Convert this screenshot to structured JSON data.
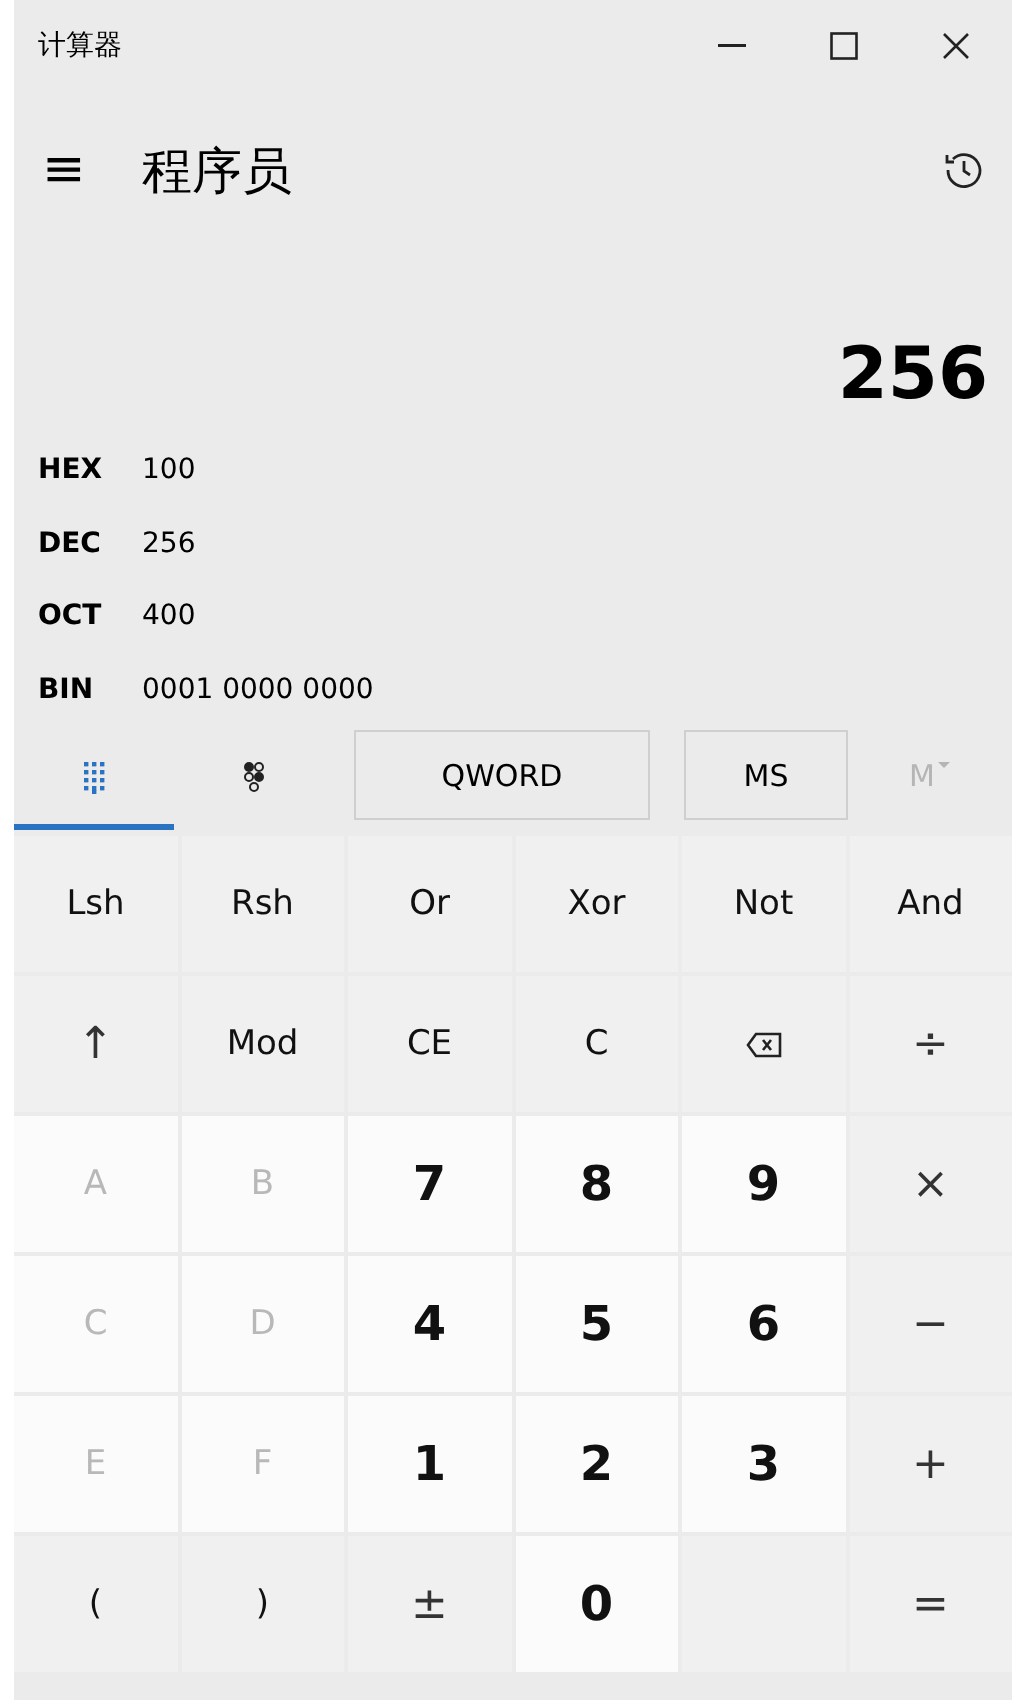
{
  "window": {
    "title": "计算器",
    "controls": [
      {
        "kind": "minimize"
      },
      {
        "kind": "maximize"
      },
      {
        "kind": "close"
      }
    ]
  },
  "header": {
    "menu": "≡",
    "mode": "程序员"
  },
  "display": {
    "value": "256"
  },
  "radix": [
    {
      "name": "HEX",
      "value": "100"
    },
    {
      "name": "DEC",
      "value": "256"
    },
    {
      "name": "OCT",
      "value": "400"
    },
    {
      "name": "BIN",
      "value": "0001 0000 0000"
    }
  ],
  "keypad_tabs": [
    {
      "kind": "keypad",
      "selected": true
    },
    {
      "kind": "bits",
      "selected": false
    }
  ],
  "word_size": "QWORD",
  "memory_buttons": [
    {
      "label": "MS",
      "disabled": false,
      "dropdown": false
    },
    {
      "label": "M",
      "disabled": true,
      "dropdown": true
    }
  ],
  "keys": [
    {
      "label": "Lsh",
      "kind": "function"
    },
    {
      "label": "Rsh",
      "kind": "function"
    },
    {
      "label": "Or",
      "kind": "function"
    },
    {
      "label": "Xor",
      "kind": "function"
    },
    {
      "label": "Not",
      "kind": "function"
    },
    {
      "label": "And",
      "kind": "function"
    },
    {
      "label": "↑",
      "kind": "operator"
    },
    {
      "label": "Mod",
      "kind": "function"
    },
    {
      "label": "CE",
      "kind": "function"
    },
    {
      "label": "C",
      "kind": "function"
    },
    {
      "kind": "backspace"
    },
    {
      "label": "÷",
      "kind": "operator"
    },
    {
      "label": "A",
      "kind": "letter"
    },
    {
      "label": "B",
      "kind": "letter"
    },
    {
      "label": "7",
      "kind": "digit"
    },
    {
      "label": "8",
      "kind": "digit"
    },
    {
      "label": "9",
      "kind": "digit"
    },
    {
      "label": "×",
      "kind": "operator"
    },
    {
      "label": "C",
      "kind": "letter"
    },
    {
      "label": "D",
      "kind": "letter"
    },
    {
      "label": "4",
      "kind": "digit"
    },
    {
      "label": "5",
      "kind": "digit"
    },
    {
      "label": "6",
      "kind": "digit"
    },
    {
      "label": "−",
      "kind": "operator"
    },
    {
      "label": "E",
      "kind": "letter"
    },
    {
      "label": "F",
      "kind": "letter"
    },
    {
      "label": "1",
      "kind": "digit"
    },
    {
      "label": "2",
      "kind": "digit"
    },
    {
      "label": "3",
      "kind": "digit"
    },
    {
      "label": "+",
      "kind": "operator"
    },
    {
      "label": "(",
      "kind": "function"
    },
    {
      "label": ")",
      "kind": "function"
    },
    {
      "label": "±",
      "kind": "operator"
    },
    {
      "label": "0",
      "kind": "digit"
    },
    {
      "kind": "blank"
    },
    {
      "label": "=",
      "kind": "operator"
    }
  ]
}
